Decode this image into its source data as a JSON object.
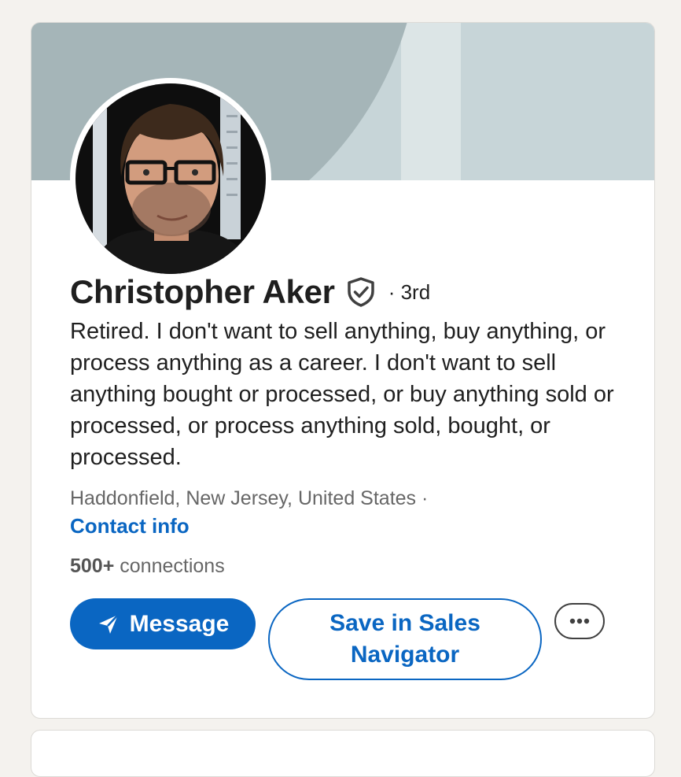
{
  "profile": {
    "name": "Christopher Aker",
    "degree": "· 3rd",
    "headline": "Retired. I don't want to sell anything, buy anything, or process anything as a career. I don't want to sell anything bought or processed, or buy anything sold or processed, or process anything sold, bought, or processed.",
    "location": "Haddonfield, New Jersey, United States ·",
    "contact_info_label": "Contact info",
    "connections_count": "500+",
    "connections_label": "connections",
    "verified_icon": "shield-check-icon"
  },
  "actions": {
    "message_label": "Message",
    "message_icon": "send-icon",
    "save_label": "Save in Sales Navigator",
    "more_icon": "ellipsis-icon"
  },
  "colors": {
    "accent": "#0a66c2",
    "banner_light": "#c7d5d8",
    "banner_dark": "#a5b5b8",
    "page_bg": "#f4f2ee"
  }
}
